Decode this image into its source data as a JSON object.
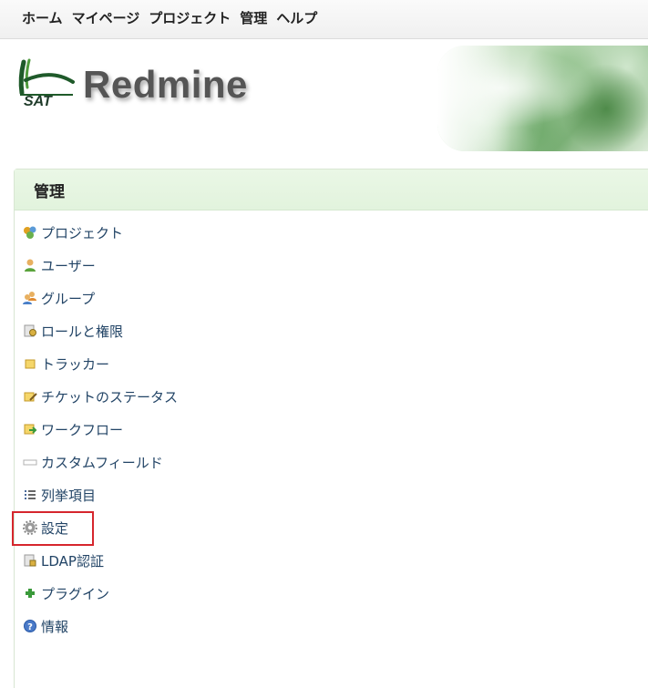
{
  "top_menu": {
    "items": [
      {
        "label": "ホーム"
      },
      {
        "label": "マイページ"
      },
      {
        "label": "プロジェクト"
      },
      {
        "label": "管理"
      },
      {
        "label": "ヘルプ"
      }
    ]
  },
  "header": {
    "logo_text": "SAT",
    "site_title": "Redmine"
  },
  "admin_panel": {
    "title": "管理",
    "items": [
      {
        "label": "プロジェクト",
        "icon": "projects-icon"
      },
      {
        "label": "ユーザー",
        "icon": "user-icon"
      },
      {
        "label": "グループ",
        "icon": "group-icon"
      },
      {
        "label": "ロールと権限",
        "icon": "roles-icon"
      },
      {
        "label": "トラッカー",
        "icon": "tracker-icon"
      },
      {
        "label": "チケットのステータス",
        "icon": "issue-status-icon"
      },
      {
        "label": "ワークフロー",
        "icon": "workflow-icon"
      },
      {
        "label": "カスタムフィールド",
        "icon": "custom-field-icon"
      },
      {
        "label": "列挙項目",
        "icon": "list-icon"
      },
      {
        "label": "設定",
        "icon": "gear-icon"
      },
      {
        "label": "LDAP認証",
        "icon": "ldap-icon"
      },
      {
        "label": "プラグイン",
        "icon": "plugin-icon"
      },
      {
        "label": "情報",
        "icon": "help-icon"
      }
    ]
  },
  "colors": {
    "link": "#224466",
    "panel_header_bg": "#e2f3dd",
    "highlight": "#d6262d"
  }
}
